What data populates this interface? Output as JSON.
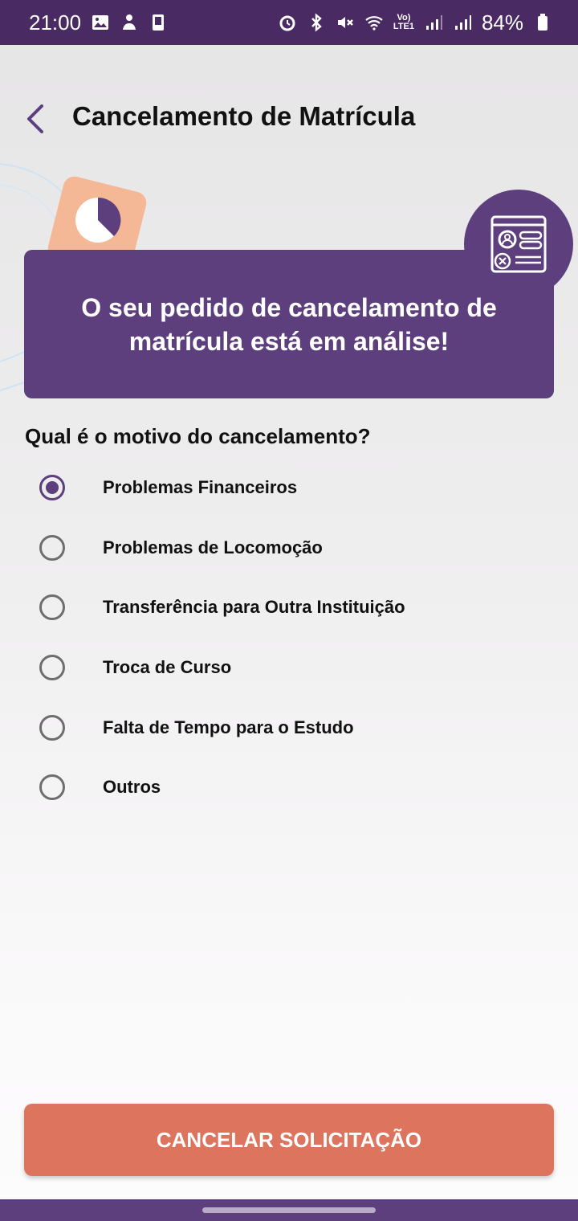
{
  "status_bar": {
    "time": "21:00",
    "lte_label_top": "Vo)",
    "lte_label_bottom": "LTE1",
    "battery": "84%"
  },
  "header": {
    "title": "Cancelamento de Matrícula"
  },
  "banner": {
    "message": "O seu pedido de cancelamento de matrícula está em análise!"
  },
  "form": {
    "question": "Qual é o motivo do cancelamento?",
    "options": [
      {
        "label": "Problemas Financeiros",
        "selected": true
      },
      {
        "label": "Problemas de Locomoção",
        "selected": false
      },
      {
        "label": "Transferência para Outra Instituição",
        "selected": false
      },
      {
        "label": "Troca de Curso",
        "selected": false
      },
      {
        "label": "Falta de Tempo para o Estudo",
        "selected": false
      },
      {
        "label": "Outros",
        "selected": false
      }
    ]
  },
  "actions": {
    "cancel_label": "CANCELAR SOLICITAÇÃO"
  },
  "colors": {
    "brand_purple": "#5c3f7c",
    "status_bar": "#4a2a63",
    "accent_orange": "#dd755e"
  }
}
